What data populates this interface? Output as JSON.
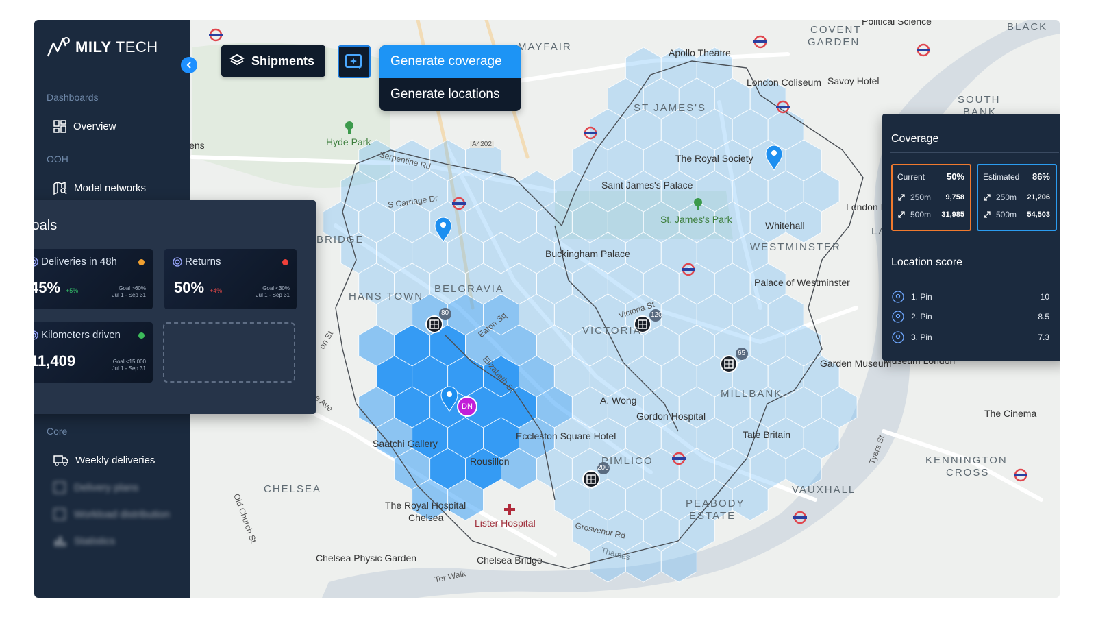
{
  "brand": {
    "name_bold": "MILY",
    "name_light": "TECH"
  },
  "sidebar": {
    "sections": [
      {
        "label": "Dashboards",
        "items": [
          {
            "label": "Overview",
            "icon": "dashboard-icon"
          }
        ]
      },
      {
        "label": "OOH",
        "items": [
          {
            "label": "Model networks",
            "icon": "map-search-icon"
          }
        ]
      },
      {
        "label": "Core",
        "items": [
          {
            "label": "Weekly deliveries",
            "icon": "truck-icon"
          },
          {
            "label": "Delivery plans",
            "icon": "plan-icon",
            "blurred": true
          },
          {
            "label": "Workload distribution",
            "icon": "network-icon",
            "blurred": true
          },
          {
            "label": "Statistics",
            "icon": "bar-chart-icon",
            "blurred": true
          }
        ]
      }
    ],
    "collapse_icon": "chevron-left-icon"
  },
  "toolbar": {
    "shipments_label": "Shipments",
    "shipments_icon": "layers-icon",
    "generate_icon": "sparkle-map-icon",
    "menu": [
      {
        "label": "Generate coverage",
        "active": true
      },
      {
        "label": "Generate locations",
        "active": false
      }
    ]
  },
  "goals": {
    "title": "Goals",
    "cards": [
      {
        "label": "Deliveries in 48h",
        "value": "45%",
        "delta": "+5%",
        "delta_color": "#35c26b",
        "goal": "Goal >60%",
        "period": "Jul 1 - Sep 31",
        "dot": "#f0a030"
      },
      {
        "label": "Returns",
        "value": "50%",
        "delta": "+4%",
        "delta_color": "#e04848",
        "goal": "Goal <30%",
        "period": "Jul 1 - Sep 31",
        "dot": "#f0403a"
      },
      {
        "label": "Kilometers driven",
        "value": "11,409",
        "delta": "",
        "delta_color": "#35c26b",
        "goal": "Goal <15,000",
        "period": "Jul 1 - Sep 31",
        "dot": "#3cbb5a"
      }
    ]
  },
  "coverage": {
    "title": "Coverage",
    "current": {
      "label": "Current",
      "pct": "50%",
      "rows": [
        {
          "r": "250m",
          "v": "9,758"
        },
        {
          "r": "500m",
          "v": "31,985"
        }
      ],
      "border": "#f07a2e"
    },
    "estimated": {
      "label": "Estimated",
      "pct": "86%",
      "rows": [
        {
          "r": "250m",
          "v": "21,206"
        },
        {
          "r": "500m",
          "v": "54,503"
        }
      ],
      "border": "#2b9cf0"
    },
    "score_title": "Location score",
    "scores": [
      {
        "label": "1. Pin",
        "v": "10"
      },
      {
        "label": "2. Pin",
        "v": "8.5"
      },
      {
        "label": "3. Pin",
        "v": "7.3"
      }
    ]
  },
  "map": {
    "districts": [
      "MAYFAIR",
      "COVENT",
      "GARDEN",
      "BLACK",
      "SOUTH",
      "BANK",
      "ST JAMES'S",
      "BRIDGE",
      "HANS TOWN",
      "BELGRAVIA",
      "VICTORIA",
      "MILLBANK",
      "PIMLICO",
      "CHELSEA",
      "VAUXHALL",
      "PEABODY",
      "ESTATE",
      "KENNINGTON",
      "CROSS",
      "WESTMINSTER",
      "LAM"
    ],
    "pois": [
      "Hyde Park",
      "Apollo Theatre",
      "London Coliseum",
      "Savoy Hotel",
      "The Royal Society",
      "Saint James's Palace",
      "St. James's Park",
      "Whitehall",
      "London Eye",
      "Buckingham Palace",
      "Palace of Westminster",
      "Garden Museum",
      "Museum London",
      "The Cinema",
      "A. Wong",
      "Gordon Hospital",
      "Tate Britain",
      "Eccleston Square Hotel",
      "Saatchi Gallery",
      "Rousillon",
      "The Royal Hospital",
      "Chelsea",
      "Lister Hospital",
      "Chelsea Physic Garden",
      "Chelsea Bridge",
      "Political Science",
      "lens"
    ],
    "roads": [
      "Serpentine Rd",
      "S Carriage Dr",
      "A4202",
      "Eaton Sq",
      "Elizabeth St",
      "Victoria St",
      "Grosvenor Rd",
      "Thames",
      "Ter Walk",
      "Old Church St",
      "Tyers St",
      "ne Ave",
      "on St"
    ],
    "cluster_counts": [
      "80",
      "120",
      "65",
      "200"
    ],
    "avatar_initials": "DN"
  }
}
